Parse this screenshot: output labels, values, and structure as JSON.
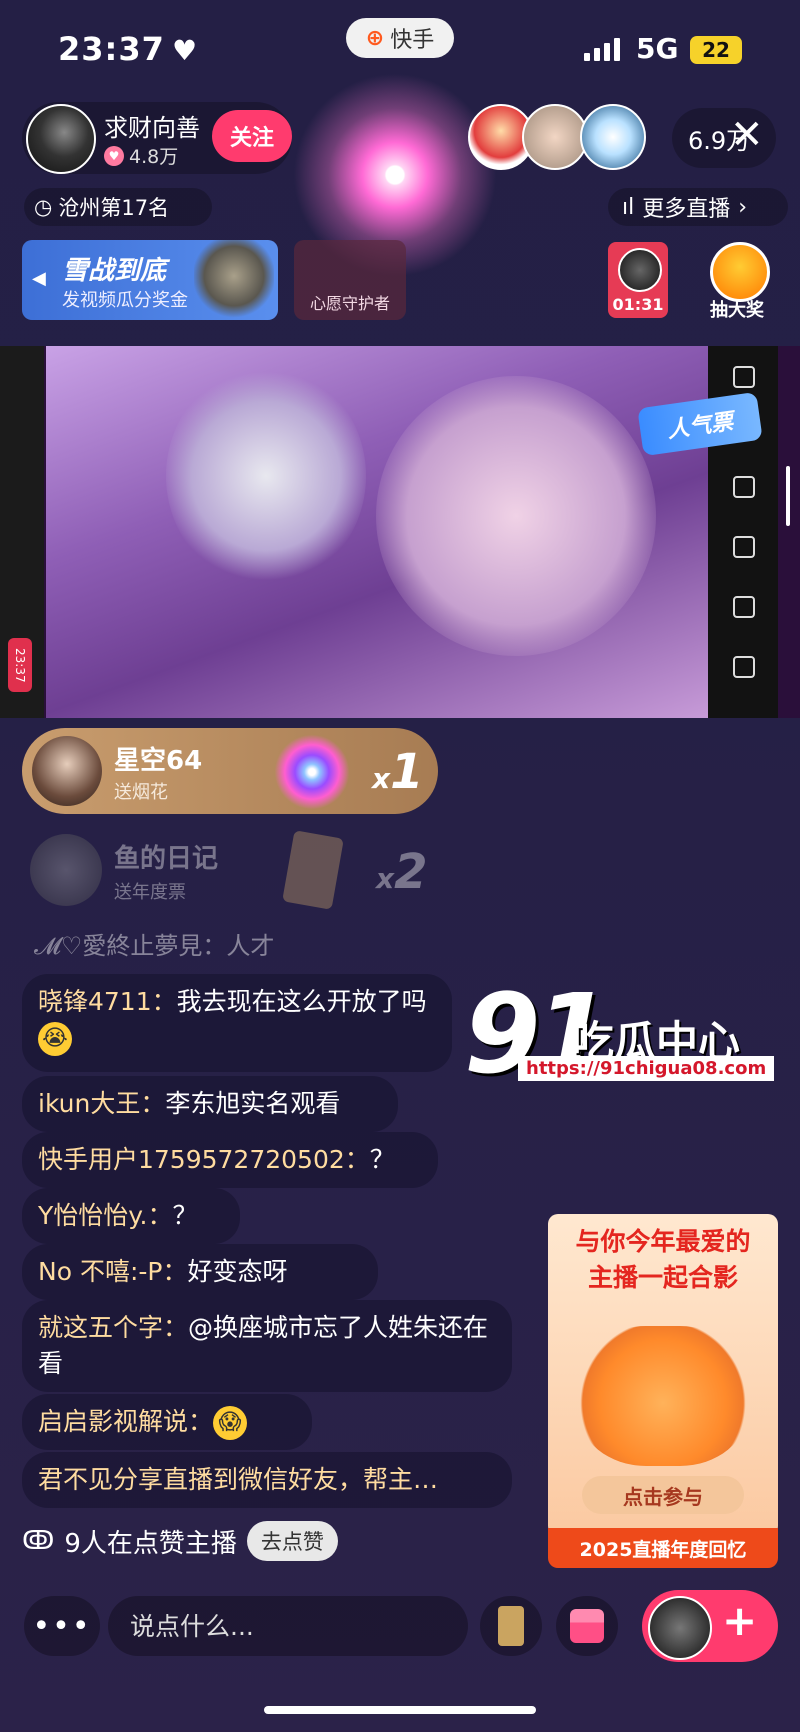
{
  "status_bar": {
    "time": "23:37",
    "network": "5G",
    "battery": "22"
  },
  "app_pill": {
    "label": "快手"
  },
  "host": {
    "name": "求财向善",
    "likes": "4.8万",
    "follow_label": "关注"
  },
  "viewers": {
    "count": "6.9万"
  },
  "rank": {
    "label": "沧州第17名"
  },
  "more_live": {
    "label": "更多直播"
  },
  "event_banner": {
    "title": "雪战到底",
    "subtitle": "发视频瓜分奖金"
  },
  "wish_card": {
    "label": "心愿守护者"
  },
  "timer_card": {
    "time": "01:31"
  },
  "draw_card": {
    "label": "抽大奖"
  },
  "popular_badge": {
    "label": "人气票"
  },
  "video": {
    "time_pill": "23:37"
  },
  "gifts": [
    {
      "name": "星空64",
      "action": "送烟花",
      "count": "1"
    },
    {
      "name": "鱼的日记",
      "action": "送年度票",
      "count": "2"
    }
  ],
  "faded_message": "𝓜♡愛終止夢見：人才",
  "chat": [
    {
      "user": "晓锋4711：",
      "text": "我去现在这么开放了吗"
    },
    {
      "user": "ikun大王：",
      "text": "李东旭实名观看"
    },
    {
      "user": "快手用户1759572720502：",
      "text": "？"
    },
    {
      "user": "Y怡怡怡y.：",
      "text": "？"
    },
    {
      "user": "No    不嘻:-P：",
      "text": "好变态呀"
    },
    {
      "user": "就这五个字：",
      "text": "@换座城市忘了人姓朱还在看"
    },
    {
      "user": "启启影视解说：",
      "text": ""
    },
    {
      "user": "君不见分享直播到微信好友，帮主…",
      "text": ""
    }
  ],
  "like_row": {
    "text": "9人在点赞主播",
    "button": "去点赞"
  },
  "watermark": {
    "number": "91",
    "text": "吃瓜中心",
    "url": "https://91chigua08.com"
  },
  "promo": {
    "title_line1": "与你今年最爱的",
    "title_line2": "主播一起合影",
    "button": "点击参与",
    "footer": "2025直播年度回忆"
  },
  "input": {
    "placeholder": "说点什么..."
  },
  "colors": {
    "accent": "#ff3b6e",
    "background": "#241f45",
    "gift_gold": "#c99d6e"
  }
}
